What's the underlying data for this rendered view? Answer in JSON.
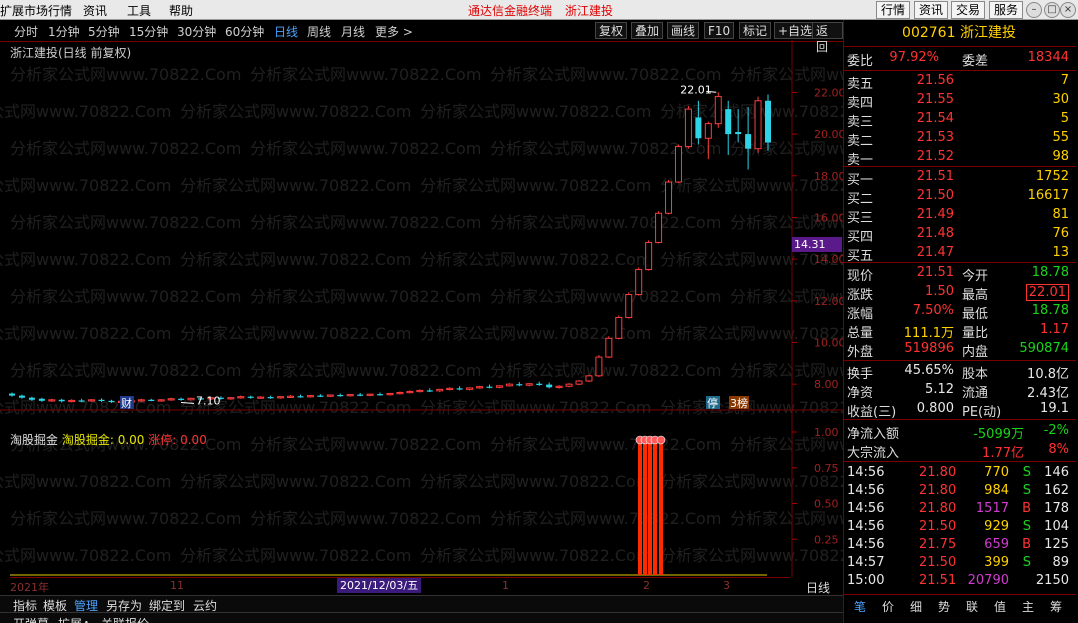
{
  "menubar": {
    "items": [
      "扩展市场行情",
      "资讯",
      "工具",
      "帮助"
    ],
    "center_title": "通达信金融终端",
    "center_stock": "浙江建投",
    "right_buttons": [
      "行情",
      "资讯",
      "交易",
      "服务"
    ]
  },
  "periods": [
    "分时",
    "1分钟",
    "5分钟",
    "15分钟",
    "30分钟",
    "60分钟",
    "日线",
    "周线",
    "月线",
    "更多 >"
  ],
  "active_period": "日线",
  "toolbar": [
    "复权",
    "叠加",
    "画线",
    "F10",
    "标记",
    "+自选",
    "返回"
  ],
  "chart_title": "浙江建投(日线 前复权)",
  "watermark": "分析家公式网www.70822.Com",
  "annotations": {
    "high_label": "22.01",
    "low_label": "7.10",
    "cai_badge": "财",
    "ting_badge": "停",
    "bang_badge": "3榜",
    "current_price_tag": "14.31"
  },
  "chart_data": {
    "type": "candlestick",
    "y_ticks": [
      "22.00",
      "20.00",
      "18.00",
      "16.00",
      "14.00",
      "12.00",
      "10.00",
      "8.00"
    ],
    "ylim": [
      7.0,
      22.5
    ],
    "indicator": {
      "name": "淘股掘金",
      "series_a_label": "淘股掘金: 0.00",
      "series_b_label": "涨停: 0.00",
      "y_ticks": [
        "1.00",
        "0.75",
        "0.50",
        "0.25"
      ]
    },
    "x_labels": [
      "2021年",
      "11",
      "2021/12/03/五",
      "1",
      "2",
      "3"
    ],
    "candles": [
      [
        7.55,
        7.6,
        7.45,
        7.4
      ],
      [
        7.45,
        7.5,
        7.35,
        7.3
      ],
      [
        7.35,
        7.4,
        7.25,
        7.2
      ],
      [
        7.3,
        7.35,
        7.2,
        7.15
      ],
      [
        7.2,
        7.3,
        7.25,
        7.15
      ],
      [
        7.25,
        7.3,
        7.18,
        7.12
      ],
      [
        7.18,
        7.28,
        7.22,
        7.12
      ],
      [
        7.22,
        7.3,
        7.2,
        7.15
      ],
      [
        7.2,
        7.28,
        7.25,
        7.15
      ],
      [
        7.25,
        7.32,
        7.2,
        7.15
      ],
      [
        7.2,
        7.25,
        7.15,
        7.1
      ],
      [
        7.15,
        7.22,
        7.18,
        7.1
      ],
      [
        7.18,
        7.25,
        7.2,
        7.12
      ],
      [
        7.2,
        7.3,
        7.25,
        7.15
      ],
      [
        7.25,
        7.3,
        7.22,
        7.18
      ],
      [
        7.22,
        7.28,
        7.25,
        7.15
      ],
      [
        7.25,
        7.35,
        7.3,
        7.2
      ],
      [
        7.3,
        7.35,
        7.25,
        7.2
      ],
      [
        7.25,
        7.35,
        7.32,
        7.22
      ],
      [
        7.32,
        7.4,
        7.3,
        7.25
      ],
      [
        7.3,
        7.38,
        7.35,
        7.25
      ],
      [
        7.35,
        7.42,
        7.3,
        7.25
      ],
      [
        7.3,
        7.38,
        7.35,
        7.25
      ],
      [
        7.35,
        7.45,
        7.4,
        7.3
      ],
      [
        7.4,
        7.45,
        7.35,
        7.3
      ],
      [
        7.35,
        7.42,
        7.38,
        7.3
      ],
      [
        7.38,
        7.45,
        7.35,
        7.3
      ],
      [
        7.35,
        7.42,
        7.4,
        7.3
      ],
      [
        7.4,
        7.48,
        7.42,
        7.35
      ],
      [
        7.42,
        7.5,
        7.4,
        7.35
      ],
      [
        7.4,
        7.48,
        7.45,
        7.35
      ],
      [
        7.45,
        7.52,
        7.42,
        7.38
      ],
      [
        7.42,
        7.5,
        7.48,
        7.38
      ],
      [
        7.48,
        7.55,
        7.45,
        7.4
      ],
      [
        7.45,
        7.52,
        7.5,
        7.4
      ],
      [
        7.5,
        7.58,
        7.48,
        7.42
      ],
      [
        7.48,
        7.55,
        7.52,
        7.42
      ],
      [
        7.52,
        7.6,
        7.5,
        7.45
      ],
      [
        7.5,
        7.58,
        7.55,
        7.45
      ],
      [
        7.55,
        7.65,
        7.6,
        7.5
      ],
      [
        7.6,
        7.7,
        7.65,
        7.55
      ],
      [
        7.65,
        7.75,
        7.7,
        7.6
      ],
      [
        7.7,
        7.8,
        7.68,
        7.62
      ],
      [
        7.68,
        7.78,
        7.75,
        7.62
      ],
      [
        7.75,
        7.85,
        7.8,
        7.7
      ],
      [
        7.8,
        7.9,
        7.75,
        7.7
      ],
      [
        7.75,
        7.85,
        7.82,
        7.7
      ],
      [
        7.82,
        7.92,
        7.88,
        7.78
      ],
      [
        7.88,
        7.98,
        7.85,
        7.8
      ],
      [
        7.85,
        7.95,
        7.92,
        7.8
      ],
      [
        7.92,
        8.05,
        8.0,
        7.88
      ],
      [
        8.0,
        8.1,
        7.95,
        7.9
      ],
      [
        7.95,
        8.05,
        8.02,
        7.9
      ],
      [
        8.02,
        8.12,
        7.98,
        7.92
      ],
      [
        7.98,
        8.08,
        7.85,
        7.8
      ],
      [
        7.85,
        7.95,
        7.9,
        7.78
      ],
      [
        7.9,
        8.05,
        8.0,
        7.85
      ],
      [
        8.0,
        8.2,
        8.15,
        7.95
      ],
      [
        8.15,
        8.45,
        8.4,
        8.1
      ],
      [
        8.4,
        9.4,
        9.3,
        8.35
      ],
      [
        9.3,
        10.3,
        10.2,
        9.25
      ],
      [
        10.2,
        11.3,
        11.2,
        10.15
      ],
      [
        11.2,
        12.4,
        12.3,
        11.15
      ],
      [
        12.3,
        13.6,
        13.5,
        12.25
      ],
      [
        13.5,
        14.9,
        14.8,
        13.45
      ],
      [
        14.8,
        16.3,
        16.2,
        14.75
      ],
      [
        16.2,
        17.8,
        17.7,
        16.15
      ],
      [
        17.7,
        19.5,
        19.4,
        17.65
      ],
      [
        19.4,
        21.35,
        21.2,
        19.3
      ],
      [
        20.8,
        21.6,
        19.8,
        19.5
      ],
      [
        19.8,
        20.6,
        20.5,
        18.8
      ],
      [
        20.5,
        22.01,
        21.8,
        20.3
      ],
      [
        21.2,
        21.6,
        20.0,
        19.0
      ],
      [
        20.1,
        21.2,
        20.0,
        19.6
      ],
      [
        20.0,
        21.3,
        19.3,
        18.3
      ],
      [
        19.3,
        21.8,
        21.6,
        19.1
      ],
      [
        21.6,
        21.9,
        19.6,
        19.2
      ]
    ],
    "limit_bars": [
      0.0,
      0.0,
      0.0,
      0.0,
      1.0
    ]
  },
  "quote": {
    "code_name": "002761 浙江建投",
    "weibi_label": "委比",
    "weibi": "97.92%",
    "weicha_label": "委差",
    "weicha": "18344",
    "asks": [
      {
        "label": "卖五",
        "price": "21.56",
        "vol": "7"
      },
      {
        "label": "卖四",
        "price": "21.55",
        "vol": "30"
      },
      {
        "label": "卖三",
        "price": "21.54",
        "vol": "5"
      },
      {
        "label": "卖二",
        "price": "21.53",
        "vol": "55"
      },
      {
        "label": "卖一",
        "price": "21.52",
        "vol": "98"
      }
    ],
    "bids": [
      {
        "label": "买一",
        "price": "21.51",
        "vol": "1752"
      },
      {
        "label": "买二",
        "price": "21.50",
        "vol": "16617"
      },
      {
        "label": "买三",
        "price": "21.49",
        "vol": "81"
      },
      {
        "label": "买四",
        "price": "21.48",
        "vol": "76"
      },
      {
        "label": "买五",
        "price": "21.47",
        "vol": "13"
      }
    ],
    "stats": [
      {
        "l1": "现价",
        "v1": "21.51",
        "c1": "red",
        "l2": "今开",
        "v2": "18.78",
        "c2": "grn"
      },
      {
        "l1": "涨跌",
        "v1": "1.50",
        "c1": "red",
        "l2": "最高",
        "v2": "22.01",
        "c2": "red"
      },
      {
        "l1": "涨幅",
        "v1": "7.50%",
        "c1": "red",
        "l2": "最低",
        "v2": "18.78",
        "c2": "grn"
      },
      {
        "l1": "总量",
        "v1": "111.1万",
        "c1": "yel",
        "l2": "量比",
        "v2": "1.17",
        "c2": "red"
      },
      {
        "l1": "外盘",
        "v1": "519896",
        "c1": "red",
        "l2": "内盘",
        "v2": "590874",
        "c2": "grn"
      }
    ],
    "stats2": [
      {
        "l1": "换手",
        "v1": "45.65%",
        "l2": "股本",
        "v2": "10.8亿"
      },
      {
        "l1": "净资",
        "v1": "5.12",
        "l2": "流通",
        "v2": "2.43亿"
      },
      {
        "l1": "收益(三)",
        "v1": "0.800",
        "l2": "PE(动)",
        "v2": "19.1"
      }
    ],
    "flow": [
      {
        "l": "净流入额",
        "v1": "-5099万",
        "c1": "grn",
        "v2": "-2%",
        "c2": "grn"
      },
      {
        "l": "大宗流入",
        "v1": "1.77亿",
        "c1": "red",
        "v2": "8%",
        "c2": "red"
      }
    ],
    "ticks": [
      {
        "t": "14:56",
        "p": "21.80",
        "v": "770",
        "s": "S",
        "n": "146"
      },
      {
        "t": "14:56",
        "p": "21.80",
        "v": "984",
        "s": "S",
        "n": "162"
      },
      {
        "t": "14:56",
        "p": "21.80",
        "v": "1517",
        "s": "B",
        "n": "178"
      },
      {
        "t": "14:56",
        "p": "21.50",
        "v": "929",
        "s": "S",
        "n": "104"
      },
      {
        "t": "14:56",
        "p": "21.75",
        "v": "659",
        "s": "B",
        "n": "125"
      },
      {
        "t": "14:57",
        "p": "21.50",
        "v": "399",
        "s": "S",
        "n": "89"
      },
      {
        "t": "15:00",
        "p": "21.51",
        "v": "20790",
        "s": "",
        "n": "2150"
      }
    ],
    "tabs": [
      "笔",
      "价",
      "细",
      "势",
      "联",
      "值",
      "主",
      "筹"
    ]
  },
  "bottom": {
    "tabs1": [
      "指标",
      "模板",
      "管理",
      "另存为",
      "绑定到",
      "云约"
    ],
    "active_tab1": "管理",
    "tabs2": [
      "开弹幕",
      "扩展∧",
      "关联报价"
    ],
    "right_label": "日线",
    "zoom_buttons": [
      "+",
      "-",
      "0"
    ]
  }
}
